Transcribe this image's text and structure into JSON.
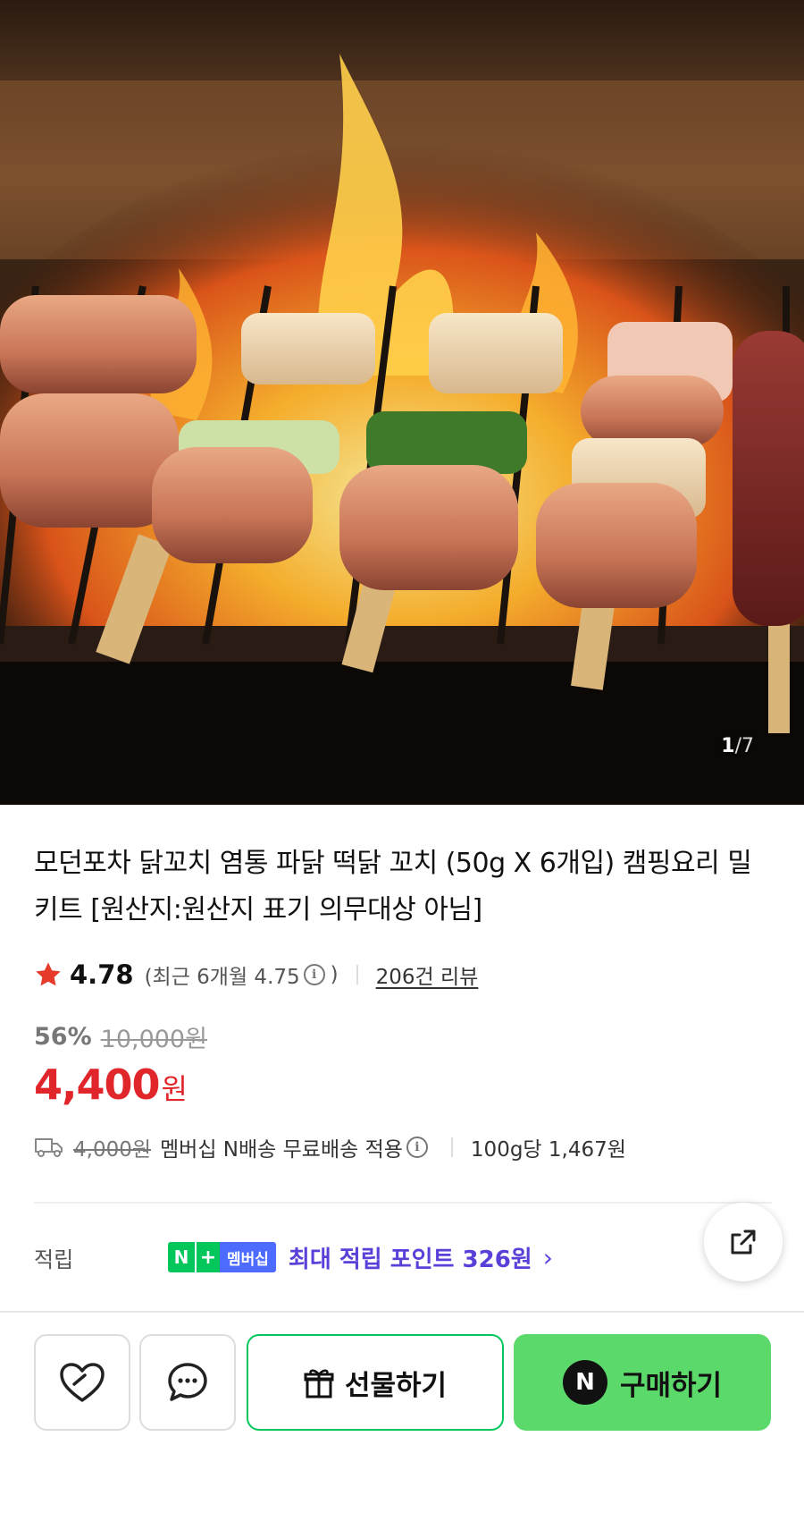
{
  "gallery": {
    "current": "1",
    "total": "/7"
  },
  "product": {
    "title": "모던포차 닭꼬치 염통 파닭 떡닭 꼬치 (50g X 6개입) 캠핑요리 밀키트 [원산지:원산지 표기 의무대상 아님]"
  },
  "rating": {
    "value": "4.78",
    "recent_label": "(최근 6개월 4.75",
    "recent_close": ")",
    "reviews": "206건 리뷰",
    "star_color": "#e63a2b",
    "icon": "star-icon"
  },
  "price": {
    "discount_rate": "56%",
    "original": "10,000원",
    "sale": "4,400",
    "unit": "원",
    "sale_color": "#e0262b"
  },
  "shipping": {
    "fee": "4,000원",
    "text": "멤버십 N배송 무료배송 적용",
    "unit_price": "100g당 1,467원"
  },
  "points": {
    "label": "적립",
    "badge_n": "N",
    "badge_plus": "+",
    "badge_member": "멤버십",
    "text": "최대 적립 포인트 326원",
    "accent": "#5b3fd9"
  },
  "actions": {
    "gift": "선물하기",
    "buy": "구매하기",
    "buy_badge": "N",
    "buy_color": "#5bd96b",
    "gift_border": "#03c75a"
  }
}
